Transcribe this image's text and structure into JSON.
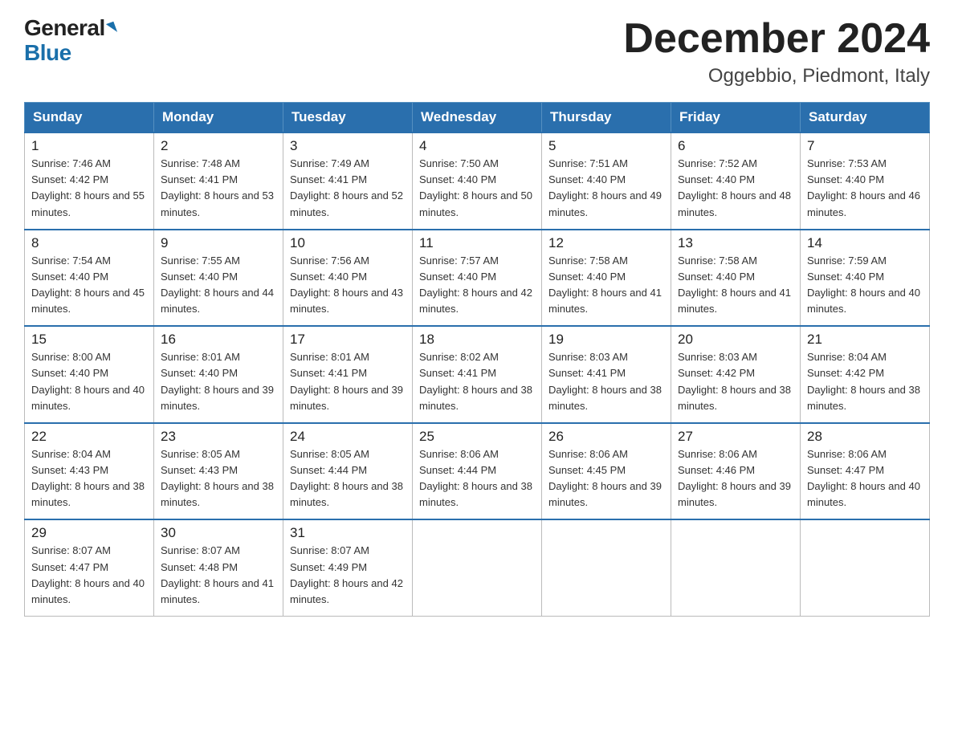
{
  "logo": {
    "general": "General",
    "blue": "Blue",
    "tagline": ""
  },
  "title": "December 2024",
  "subtitle": "Oggebbio, Piedmont, Italy",
  "days_of_week": [
    "Sunday",
    "Monday",
    "Tuesday",
    "Wednesday",
    "Thursday",
    "Friday",
    "Saturday"
  ],
  "weeks": [
    [
      {
        "day": "1",
        "sunrise": "7:46 AM",
        "sunset": "4:42 PM",
        "daylight": "8 hours and 55 minutes."
      },
      {
        "day": "2",
        "sunrise": "7:48 AM",
        "sunset": "4:41 PM",
        "daylight": "8 hours and 53 minutes."
      },
      {
        "day": "3",
        "sunrise": "7:49 AM",
        "sunset": "4:41 PM",
        "daylight": "8 hours and 52 minutes."
      },
      {
        "day": "4",
        "sunrise": "7:50 AM",
        "sunset": "4:40 PM",
        "daylight": "8 hours and 50 minutes."
      },
      {
        "day": "5",
        "sunrise": "7:51 AM",
        "sunset": "4:40 PM",
        "daylight": "8 hours and 49 minutes."
      },
      {
        "day": "6",
        "sunrise": "7:52 AM",
        "sunset": "4:40 PM",
        "daylight": "8 hours and 48 minutes."
      },
      {
        "day": "7",
        "sunrise": "7:53 AM",
        "sunset": "4:40 PM",
        "daylight": "8 hours and 46 minutes."
      }
    ],
    [
      {
        "day": "8",
        "sunrise": "7:54 AM",
        "sunset": "4:40 PM",
        "daylight": "8 hours and 45 minutes."
      },
      {
        "day": "9",
        "sunrise": "7:55 AM",
        "sunset": "4:40 PM",
        "daylight": "8 hours and 44 minutes."
      },
      {
        "day": "10",
        "sunrise": "7:56 AM",
        "sunset": "4:40 PM",
        "daylight": "8 hours and 43 minutes."
      },
      {
        "day": "11",
        "sunrise": "7:57 AM",
        "sunset": "4:40 PM",
        "daylight": "8 hours and 42 minutes."
      },
      {
        "day": "12",
        "sunrise": "7:58 AM",
        "sunset": "4:40 PM",
        "daylight": "8 hours and 41 minutes."
      },
      {
        "day": "13",
        "sunrise": "7:58 AM",
        "sunset": "4:40 PM",
        "daylight": "8 hours and 41 minutes."
      },
      {
        "day": "14",
        "sunrise": "7:59 AM",
        "sunset": "4:40 PM",
        "daylight": "8 hours and 40 minutes."
      }
    ],
    [
      {
        "day": "15",
        "sunrise": "8:00 AM",
        "sunset": "4:40 PM",
        "daylight": "8 hours and 40 minutes."
      },
      {
        "day": "16",
        "sunrise": "8:01 AM",
        "sunset": "4:40 PM",
        "daylight": "8 hours and 39 minutes."
      },
      {
        "day": "17",
        "sunrise": "8:01 AM",
        "sunset": "4:41 PM",
        "daylight": "8 hours and 39 minutes."
      },
      {
        "day": "18",
        "sunrise": "8:02 AM",
        "sunset": "4:41 PM",
        "daylight": "8 hours and 38 minutes."
      },
      {
        "day": "19",
        "sunrise": "8:03 AM",
        "sunset": "4:41 PM",
        "daylight": "8 hours and 38 minutes."
      },
      {
        "day": "20",
        "sunrise": "8:03 AM",
        "sunset": "4:42 PM",
        "daylight": "8 hours and 38 minutes."
      },
      {
        "day": "21",
        "sunrise": "8:04 AM",
        "sunset": "4:42 PM",
        "daylight": "8 hours and 38 minutes."
      }
    ],
    [
      {
        "day": "22",
        "sunrise": "8:04 AM",
        "sunset": "4:43 PM",
        "daylight": "8 hours and 38 minutes."
      },
      {
        "day": "23",
        "sunrise": "8:05 AM",
        "sunset": "4:43 PM",
        "daylight": "8 hours and 38 minutes."
      },
      {
        "day": "24",
        "sunrise": "8:05 AM",
        "sunset": "4:44 PM",
        "daylight": "8 hours and 38 minutes."
      },
      {
        "day": "25",
        "sunrise": "8:06 AM",
        "sunset": "4:44 PM",
        "daylight": "8 hours and 38 minutes."
      },
      {
        "day": "26",
        "sunrise": "8:06 AM",
        "sunset": "4:45 PM",
        "daylight": "8 hours and 39 minutes."
      },
      {
        "day": "27",
        "sunrise": "8:06 AM",
        "sunset": "4:46 PM",
        "daylight": "8 hours and 39 minutes."
      },
      {
        "day": "28",
        "sunrise": "8:06 AM",
        "sunset": "4:47 PM",
        "daylight": "8 hours and 40 minutes."
      }
    ],
    [
      {
        "day": "29",
        "sunrise": "8:07 AM",
        "sunset": "4:47 PM",
        "daylight": "8 hours and 40 minutes."
      },
      {
        "day": "30",
        "sunrise": "8:07 AM",
        "sunset": "4:48 PM",
        "daylight": "8 hours and 41 minutes."
      },
      {
        "day": "31",
        "sunrise": "8:07 AM",
        "sunset": "4:49 PM",
        "daylight": "8 hours and 42 minutes."
      },
      null,
      null,
      null,
      null
    ]
  ]
}
